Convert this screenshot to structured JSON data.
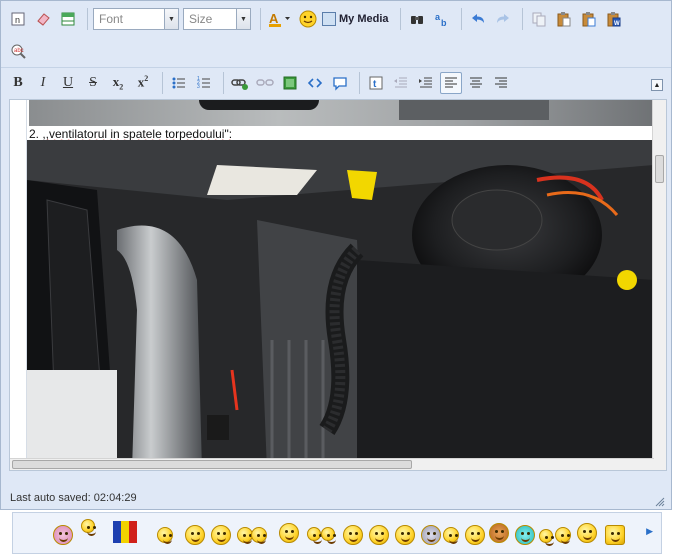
{
  "toolbar": {
    "font_placeholder": "Font",
    "size_placeholder": "Size",
    "my_media_label": "My Media"
  },
  "content": {
    "caption_prefix": "2. ",
    "caption_text": ",,ventilatorul in spatele torpedoului\":"
  },
  "status": {
    "last_saved": "Last auto saved: 02:04:29"
  },
  "colors": {
    "toolbar_bg": "#dfe8f6",
    "border": "#a7b8cf",
    "accent": "#2a6fc8"
  }
}
